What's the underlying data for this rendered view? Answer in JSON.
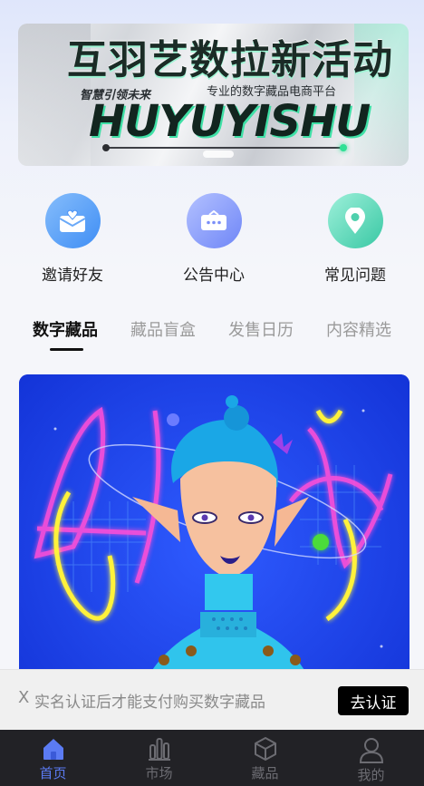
{
  "banner": {
    "title": "互羽艺数拉新活动",
    "sub_left": "智慧引领未来",
    "sub_right": "专业的数字藏品电商平台",
    "brand": "HUYUYISHU"
  },
  "quick_menu": [
    {
      "label": "邀请好友",
      "icon": "mail-heart-icon"
    },
    {
      "label": "公告中心",
      "icon": "message-icon"
    },
    {
      "label": "常见问题",
      "icon": "location-pin-icon"
    }
  ],
  "tabs": [
    {
      "label": "数字藏品",
      "active": true
    },
    {
      "label": "藏品盲盒",
      "active": false
    },
    {
      "label": "发售日历",
      "active": false
    },
    {
      "label": "内容精选",
      "active": false
    }
  ],
  "notice": {
    "close": "X",
    "text": "实名认证后才能支付购买数字藏品",
    "button": "去认证"
  },
  "bottom_nav": [
    {
      "label": "首页",
      "icon": "home-icon",
      "active": true
    },
    {
      "label": "市场",
      "icon": "bar-chart-icon",
      "active": false
    },
    {
      "label": "藏品",
      "icon": "cube-icon",
      "active": false
    },
    {
      "label": "我的",
      "icon": "user-icon",
      "active": false
    }
  ],
  "colors": {
    "accent": "#5b7bf3",
    "nav_bg": "#222226",
    "card_bg": "#1a3fe8"
  }
}
